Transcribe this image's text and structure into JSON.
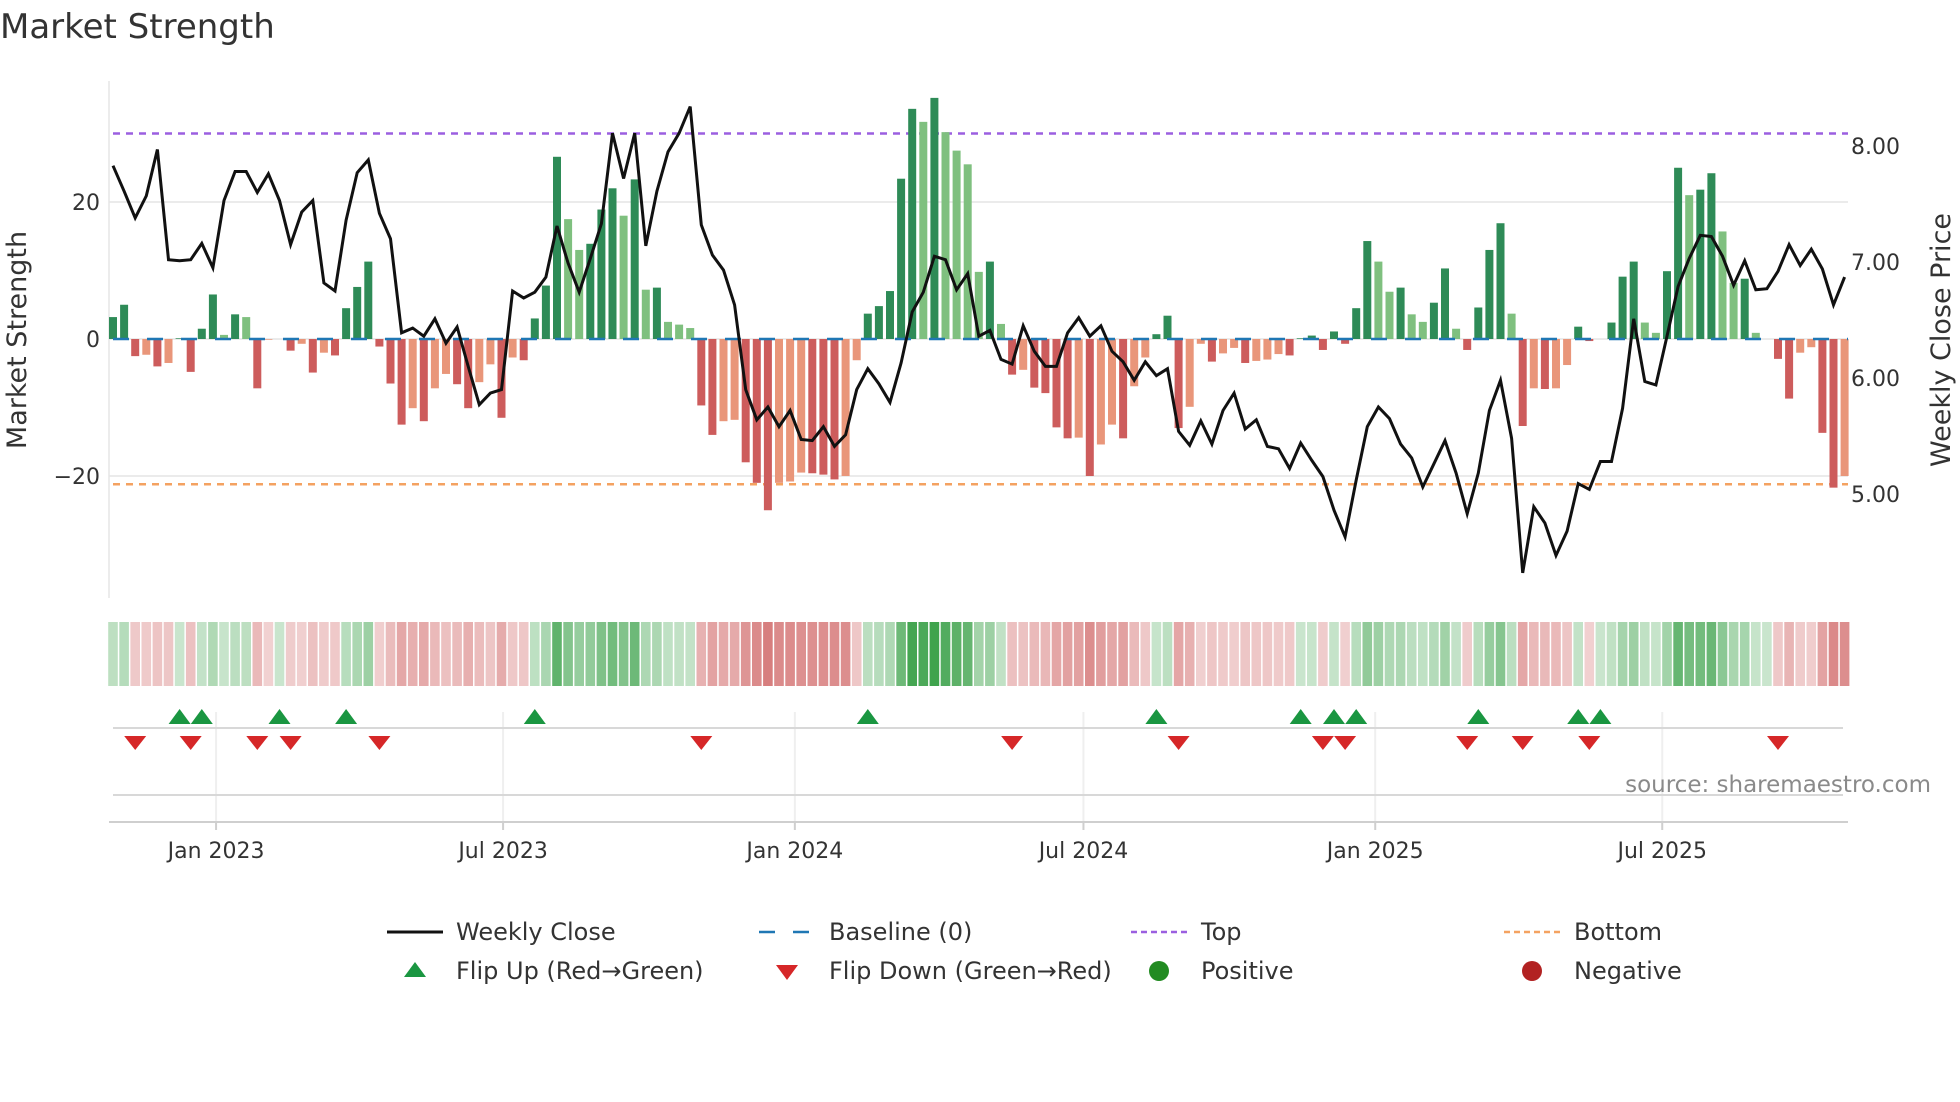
{
  "title": "Market Strength",
  "source": "source: sharemaestro.com",
  "colors": {
    "strong_up": "#2e8b57",
    "weak_up": "#7fc07f",
    "strong_down": "#cd5c5c",
    "weak_down": "#e9967a",
    "close": "#111111",
    "baseline": "#1f77b4",
    "top": "#9b5fe0",
    "bottom": "#f4a261",
    "flip_up": "#1a9641",
    "flip_down": "#d62728",
    "positive": "#228b22",
    "negative": "#b22222",
    "grid": "#ebebeb",
    "heat_pos": "#3fa34d",
    "heat_neg": "#cd5c5c"
  },
  "legend": [
    {
      "label": "Weekly Close",
      "kind": "line"
    },
    {
      "label": "Baseline (0)",
      "kind": "dash"
    },
    {
      "label": "Top",
      "kind": "dot-top"
    },
    {
      "label": "Bottom",
      "kind": "dot-bottom"
    },
    {
      "label": "Flip Up (Red→Green)",
      "kind": "tri-up"
    },
    {
      "label": "Flip Down (Green→Red)",
      "kind": "tri-down"
    },
    {
      "label": "Positive",
      "kind": "circle-pos"
    },
    {
      "label": "Negative",
      "kind": "circle-neg"
    }
  ],
  "chart_data": {
    "type": "bar",
    "title": "Market Strength",
    "ylabel": "Market Strength",
    "y2label": "Weekly Close Price",
    "ylim": [
      -38,
      38
    ],
    "y2lim": [
      4.1,
      8.56
    ],
    "yticks": [
      {
        "v": 20,
        "label": "20"
      },
      {
        "v": 0,
        "label": "0"
      },
      {
        "v": -20,
        "label": "−20"
      }
    ],
    "y2ticks": [
      {
        "v": 8,
        "label": "8.00"
      },
      {
        "v": 7,
        "label": "7.00"
      },
      {
        "v": 6,
        "label": "6.00"
      },
      {
        "v": 5,
        "label": "5.00"
      }
    ],
    "x_start": "2022-10-28",
    "x_interval": "weekly",
    "xticks": [
      {
        "date": "2023-01-01",
        "label": "Jan 2023"
      },
      {
        "date": "2023-07-01",
        "label": "Jul 2023"
      },
      {
        "date": "2024-01-01",
        "label": "Jan 2024"
      },
      {
        "date": "2024-07-01",
        "label": "Jul 2024"
      },
      {
        "date": "2025-01-01",
        "label": "Jan 2025"
      },
      {
        "date": "2025-07-01",
        "label": "Jul 2025"
      }
    ],
    "top_level": 30,
    "bottom_level": -21.2,
    "baseline": 0,
    "grid": true,
    "legend_position": "bottom",
    "strength": [
      3.2,
      5.0,
      -2.5,
      -2.3,
      -4.0,
      -3.5,
      0.1,
      -4.8,
      1.5,
      6.5,
      0.6,
      3.6,
      3.2,
      -7.2,
      -0.1,
      0.0,
      -1.7,
      -0.7,
      -4.9,
      -2.0,
      -2.4,
      4.5,
      7.6,
      11.3,
      -1.1,
      -6.5,
      -12.5,
      -10.1,
      -12.0,
      -7.2,
      -5.1,
      -6.6,
      -10.1,
      -6.3,
      -3.7,
      -11.5,
      -2.7,
      -3.1,
      3.0,
      7.8,
      26.6,
      17.5,
      13.0,
      13.9,
      18.9,
      22.0,
      18.0,
      23.3,
      7.2,
      7.5,
      2.5,
      2.1,
      1.6,
      -9.7,
      -14.0,
      -12.0,
      -11.8,
      -18.0,
      -21.0,
      -25.0,
      -21.0,
      -20.8,
      -19.5,
      -19.6,
      -19.8,
      -20.5,
      -20.0,
      -3.1,
      3.7,
      4.8,
      7.0,
      23.4,
      33.6,
      31.7,
      35.2,
      30.2,
      27.5,
      25.5,
      9.8,
      11.3,
      2.2,
      -5.2,
      -4.5,
      -7.1,
      -7.9,
      -12.9,
      -14.5,
      -14.4,
      -20.0,
      -15.4,
      -12.5,
      -14.5,
      -6.9,
      -2.7,
      0.7,
      3.4,
      -13.0,
      -9.9,
      -0.7,
      -3.3,
      -2.1,
      -1.3,
      -3.5,
      -3.2,
      -3.0,
      -2.2,
      -2.4,
      0.1,
      0.5,
      -1.6,
      1.1,
      -0.7,
      4.5,
      14.3,
      11.3,
      6.9,
      7.5,
      3.6,
      2.5,
      5.3,
      10.3,
      1.5,
      -1.6,
      4.6,
      13.0,
      16.9,
      3.7,
      -12.7,
      -7.2,
      -7.3,
      -7.2,
      -3.8,
      1.8,
      -0.3,
      0.0,
      2.4,
      9.1,
      11.3,
      2.4,
      0.9,
      9.9,
      25.0,
      21.0,
      21.8,
      24.2,
      15.7,
      8.2,
      8.8,
      0.9,
      0.0,
      -2.9,
      -8.7,
      -2.0,
      -1.2,
      -13.7,
      -21.7,
      -20.0
    ],
    "weekly_close": [
      7.83,
      7.61,
      7.38,
      7.57,
      7.97,
      7.02,
      7.01,
      7.02,
      7.16,
      6.95,
      7.53,
      7.78,
      7.78,
      7.6,
      7.76,
      7.53,
      7.15,
      7.43,
      7.53,
      6.82,
      6.75,
      7.36,
      7.77,
      7.88,
      7.42,
      7.2,
      6.39,
      6.43,
      6.36,
      6.51,
      6.3,
      6.44,
      6.1,
      5.77,
      5.87,
      5.9,
      6.75,
      6.69,
      6.74,
      6.87,
      7.31,
      6.99,
      6.74,
      7.03,
      7.33,
      8.11,
      7.72,
      8.11,
      7.14,
      7.61,
      7.95,
      8.11,
      8.34,
      7.32,
      7.06,
      6.93,
      6.63,
      5.9,
      5.64,
      5.75,
      5.58,
      5.72,
      5.47,
      5.46,
      5.58,
      5.41,
      5.51,
      5.9,
      6.08,
      5.95,
      5.79,
      6.13,
      6.57,
      6.74,
      7.05,
      7.02,
      6.76,
      6.9,
      6.36,
      6.41,
      6.16,
      6.12,
      6.45,
      6.23,
      6.1,
      6.1,
      6.39,
      6.52,
      6.36,
      6.45,
      6.23,
      6.14,
      5.98,
      6.14,
      6.02,
      6.08,
      5.54,
      5.42,
      5.63,
      5.43,
      5.72,
      5.87,
      5.56,
      5.64,
      5.41,
      5.39,
      5.22,
      5.44,
      5.29,
      5.15,
      4.86,
      4.63,
      5.12,
      5.58,
      5.75,
      5.65,
      5.43,
      5.31,
      5.06,
      5.26,
      5.46,
      5.18,
      4.83,
      5.18,
      5.72,
      5.98,
      5.48,
      4.32,
      4.89,
      4.75,
      4.47,
      4.68,
      5.09,
      5.04,
      5.28,
      5.28,
      5.74,
      6.51,
      5.97,
      5.94,
      6.36,
      6.79,
      7.03,
      7.23,
      7.22,
      7.05,
      6.8,
      7.01,
      6.76,
      6.77,
      6.92,
      7.15,
      6.97,
      7.11,
      6.94,
      6.63,
      6.87
    ]
  }
}
